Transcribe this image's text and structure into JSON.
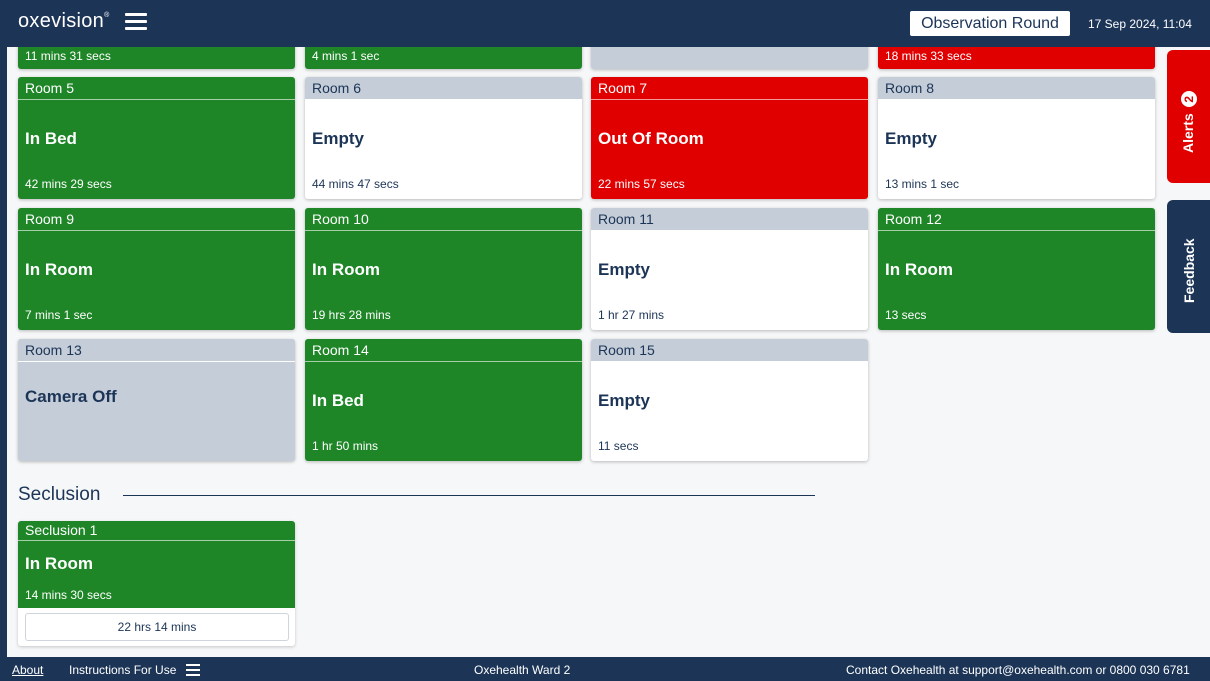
{
  "header": {
    "logo": "oxevision",
    "logo_mark": "®",
    "observation_button": "Observation Round",
    "datetime": "17 Sep 2024, 11:04"
  },
  "top_partial": [
    {
      "time": "11 mins 31 secs",
      "color": "green"
    },
    {
      "time": "4 mins 1 sec",
      "color": "green"
    },
    {
      "time": "",
      "color": "grey"
    },
    {
      "time": "18 mins 33 secs",
      "color": "red"
    }
  ],
  "rooms": [
    {
      "title": "Room 5",
      "status": "In Bed",
      "time": "42 mins 29 secs",
      "color": "green"
    },
    {
      "title": "Room 6",
      "status": "Empty",
      "time": "44 mins 47 secs",
      "color": "white"
    },
    {
      "title": "Room 7",
      "status": "Out Of Room",
      "time": "22 mins 57 secs",
      "color": "red"
    },
    {
      "title": "Room 8",
      "status": "Empty",
      "time": "13 mins 1 sec",
      "color": "white"
    },
    {
      "title": "Room 9",
      "status": "In Room",
      "time": "7 mins 1 sec",
      "color": "green"
    },
    {
      "title": "Room 10",
      "status": "In Room",
      "time": "19 hrs 28 mins",
      "color": "green"
    },
    {
      "title": "Room 11",
      "status": "Empty",
      "time": "1 hr 27 mins",
      "color": "white"
    },
    {
      "title": "Room 12",
      "status": "In Room",
      "time": "13 secs",
      "color": "green"
    },
    {
      "title": "Room 13",
      "status": "Camera Off",
      "time": "",
      "color": "grey"
    },
    {
      "title": "Room 14",
      "status": "In Bed",
      "time": "1 hr 50 mins",
      "color": "green"
    },
    {
      "title": "Room 15",
      "status": "Empty",
      "time": "11 secs",
      "color": "white"
    }
  ],
  "seclusion": {
    "heading": "Seclusion",
    "card": {
      "title": "Seclusion 1",
      "status": "In Room",
      "time": "14 mins 30 secs",
      "timer": "22 hrs 14 mins"
    }
  },
  "side_tabs": {
    "alerts_label": "Alerts",
    "alerts_count": "2",
    "feedback_label": "Feedback"
  },
  "footer": {
    "about": "About",
    "instructions": "Instructions For Use",
    "ward": "Oxehealth Ward 2",
    "contact": "Contact Oxehealth at support@oxehealth.com or 0800 030 6781"
  },
  "colors": {
    "navy": "#1c3557",
    "green": "#1f8628",
    "red": "#e00000",
    "grey": "#c4cdd8"
  }
}
